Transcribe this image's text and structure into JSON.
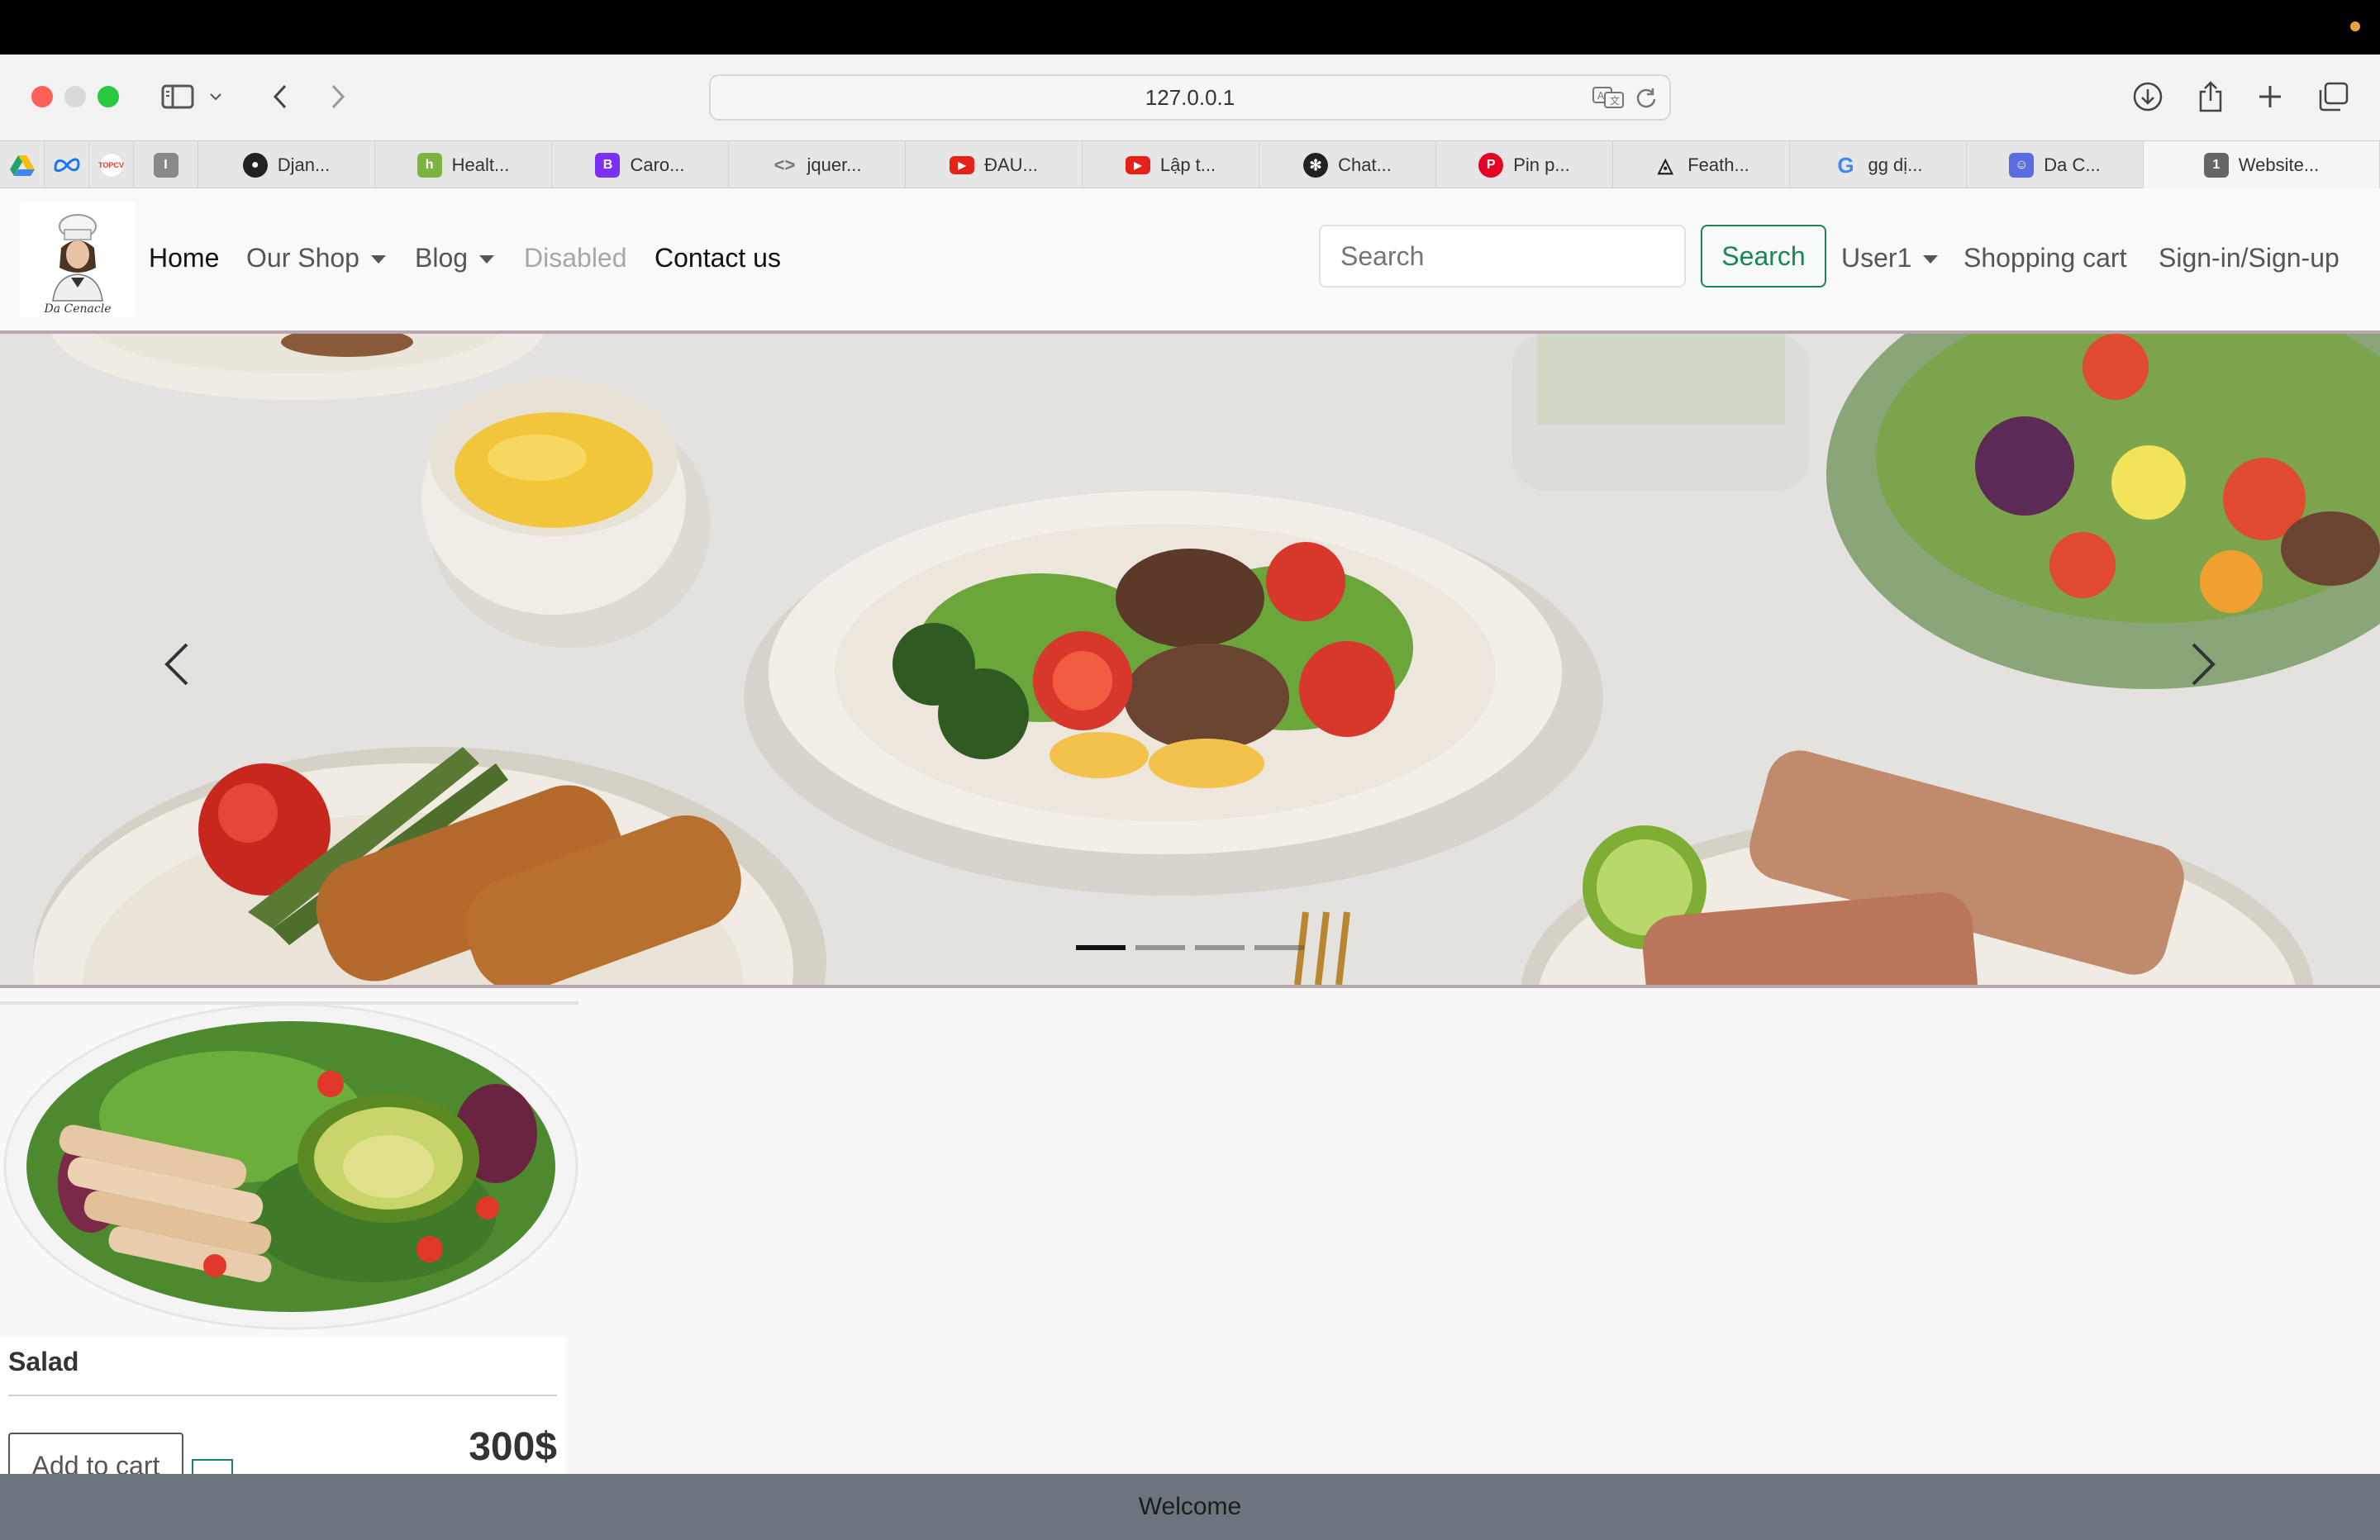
{
  "browser": {
    "url": "127.0.0.1",
    "pinned_tabs": [
      {
        "icon": "google-drive-icon",
        "color": "#1fa463"
      },
      {
        "icon": "meta-icon",
        "color": "#1877f2"
      },
      {
        "icon": "topcv-icon",
        "color": "#e53935"
      },
      {
        "icon": "instapaper-icon",
        "color": "#888888"
      }
    ],
    "tabs": [
      {
        "label": "Djan...",
        "icon": "github-icon",
        "color": "#222222"
      },
      {
        "label": "Healt...",
        "icon": "h-icon",
        "color": "#7cb342"
      },
      {
        "label": "Caro...",
        "icon": "bootstrap-icon",
        "color": "#7b2ff7"
      },
      {
        "label": "jquer...",
        "icon": "code-icon",
        "color": "#777777"
      },
      {
        "label": "ĐAU...",
        "icon": "youtube-icon",
        "color": "#e62117"
      },
      {
        "label": "Lập t...",
        "icon": "youtube-icon",
        "color": "#e62117"
      },
      {
        "label": "Chat...",
        "icon": "openai-icon",
        "color": "#222222"
      },
      {
        "label": "Pin p...",
        "icon": "pinterest-icon",
        "color": "#e60023"
      },
      {
        "label": "Feath...",
        "icon": "feather-icon",
        "color": "#222222"
      },
      {
        "label": "gg dị...",
        "icon": "google-icon",
        "color": "#4285f4"
      },
      {
        "label": "Da C...",
        "icon": "chatbot-icon",
        "color": "#5b6ee1"
      },
      {
        "label": "Website...",
        "icon": "number-one-icon",
        "color": "#666666"
      }
    ]
  },
  "navbar": {
    "links": {
      "home": "Home",
      "our_shop": "Our Shop",
      "blog": "Blog",
      "disabled": "Disabled",
      "contact": "Contact us"
    },
    "search_placeholder": "Search",
    "search_button": "Search",
    "user": "User1",
    "cart": "Shopping cart",
    "signin": "Sign-in/Sign-up"
  },
  "carousel": {
    "slide_count": 4,
    "active_index": 0
  },
  "product": {
    "name": "Salad",
    "add_to_cart": "Add to cart",
    "price": "300$"
  },
  "footer": {
    "text": "Welcome"
  },
  "colors": {
    "success": "#198754",
    "footer_bg": "#6c757d",
    "navbar_bg": "#f8f9fa"
  }
}
